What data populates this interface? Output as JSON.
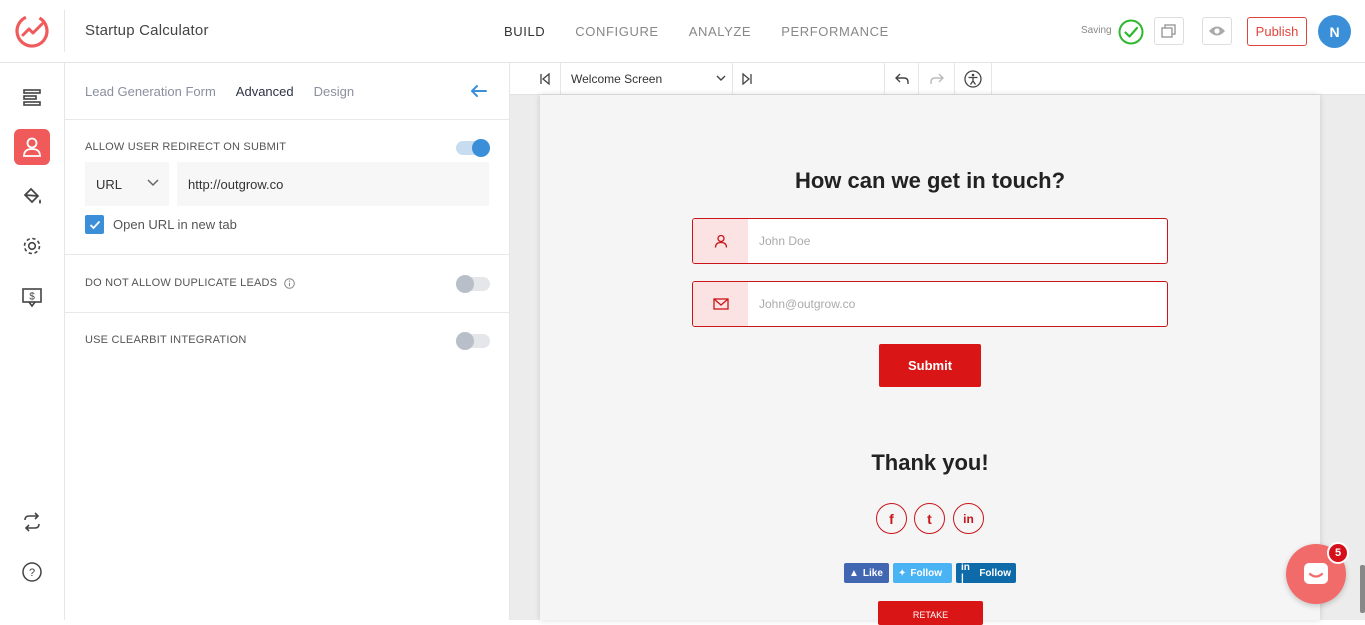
{
  "app": {
    "title": "Startup Calculator",
    "saving_text": "Saving",
    "publish_label": "Publish",
    "avatar_initial": "N"
  },
  "main_tabs": [
    {
      "label": "BUILD",
      "active": true
    },
    {
      "label": "CONFIGURE",
      "active": false
    },
    {
      "label": "ANALYZE",
      "active": false
    },
    {
      "label": "PERFORMANCE",
      "active": false
    }
  ],
  "rail_icons": [
    "layout-icon",
    "user-icon",
    "paint-bucket-icon",
    "gear-icon",
    "pricing-icon",
    "sync-icon",
    "help-icon"
  ],
  "panel": {
    "tabs": [
      {
        "label": "Lead Generation Form",
        "active": false
      },
      {
        "label": "Advanced",
        "active": true
      },
      {
        "label": "Design",
        "active": false
      }
    ],
    "redirect": {
      "label": "ALLOW USER REDIRECT ON SUBMIT",
      "enabled": true,
      "type_value": "URL",
      "url_value": "http://outgrow.co",
      "open_new_tab_label": "Open URL in new tab",
      "open_new_tab_checked": true
    },
    "duplicate_leads": {
      "label": "DO NOT ALLOW DUPLICATE LEADS",
      "enabled": false
    },
    "clearbit": {
      "label": "USE CLEARBIT INTEGRATION",
      "enabled": false
    }
  },
  "preview": {
    "screen_select": "Welcome Screen",
    "form_title": "How can we get in touch?",
    "name_placeholder": "John Doe",
    "email_placeholder": "John@outgrow.co",
    "submit_label": "Submit",
    "thanks_title": "Thank you!",
    "share_buttons": [
      {
        "label": "Like",
        "color": "#4267b2"
      },
      {
        "label": "Follow",
        "color": "#4ab3f4"
      },
      {
        "label": "Follow",
        "color": "#0e6aa8"
      }
    ],
    "retake_label": "RETAKE"
  },
  "chat": {
    "badge_count": "5"
  },
  "colors": {
    "accent_red": "#d91515",
    "publish_red": "#e0453b",
    "blue": "#3a8fd8",
    "rail_active": "#f05a5a",
    "success_green": "#2eb82e"
  }
}
